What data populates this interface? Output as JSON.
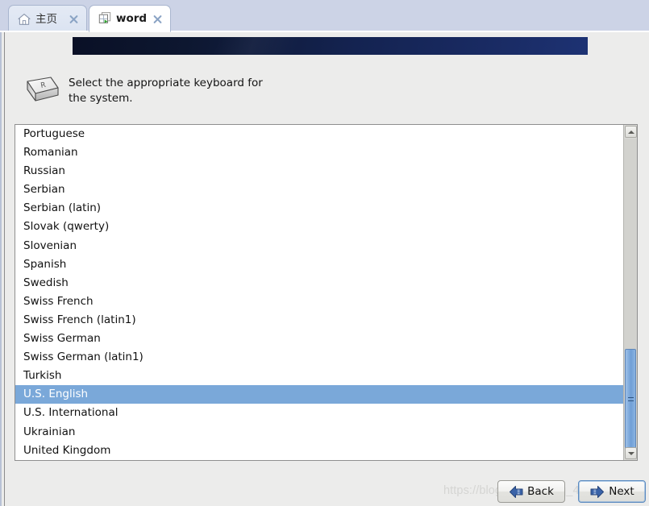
{
  "window": {
    "tabs": [
      {
        "label": "主页",
        "icon": "home-icon",
        "active": false,
        "close_icon": "close-icon"
      },
      {
        "label": "word",
        "icon": "app-window-play-icon",
        "active": true,
        "close_icon": "close-icon"
      }
    ]
  },
  "installer": {
    "banner": {
      "gradient_from": "#0a1026",
      "gradient_to": "#1d3273"
    },
    "header": {
      "icon": "keyboard-keycap-icon",
      "keycap_letter": "R",
      "text": "Select the appropriate keyboard for the system."
    },
    "keyboard_list": {
      "items": [
        "Portuguese",
        "Romanian",
        "Russian",
        "Serbian",
        "Serbian (latin)",
        "Slovak (qwerty)",
        "Slovenian",
        "Spanish",
        "Swedish",
        "Swiss French",
        "Swiss French (latin1)",
        "Swiss German",
        "Swiss German (latin1)",
        "Turkish",
        "U.S. English",
        "U.S. International",
        "Ukrainian",
        "United Kingdom"
      ],
      "selected": "U.S. English",
      "selection_color": "#7aa8d9"
    },
    "scrollbar": {
      "up_icon": "chevron-up-icon",
      "down_icon": "chevron-down-icon",
      "thumb_color": "#6f9fd6"
    },
    "footer": {
      "watermark": "https://blog.csdn.net/qq_44389665",
      "back_button": {
        "label": "Back",
        "icon": "arrow-left-icon"
      },
      "next_button": {
        "label": "Next",
        "icon": "arrow-right-icon",
        "focused": true
      }
    }
  }
}
